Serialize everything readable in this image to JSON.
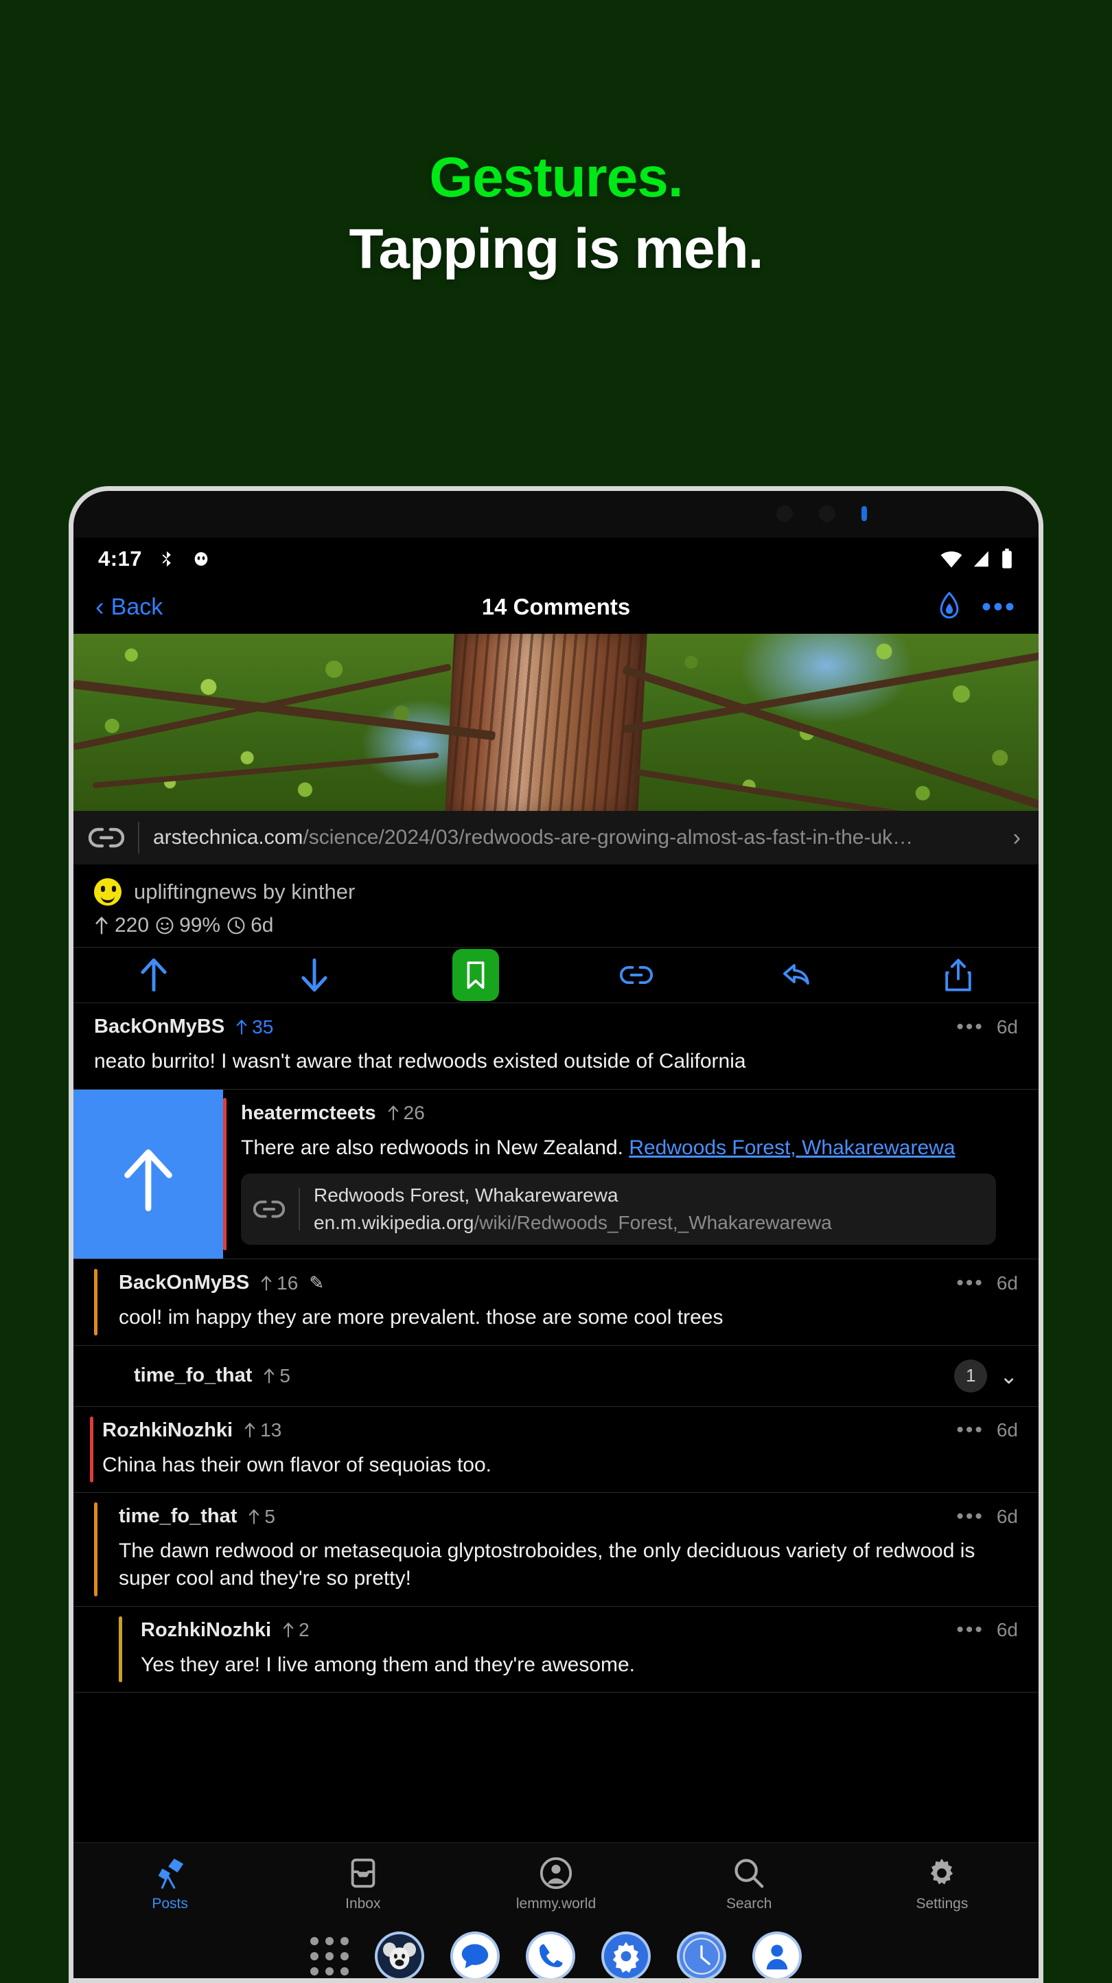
{
  "promo": {
    "line1": "Gestures.",
    "line2": "Tapping is meh.",
    "accent_color": "#00e815",
    "background_color": "#0a2d06"
  },
  "status_bar": {
    "time": "4:17",
    "icons": [
      "bluetooth-icon",
      "app-notification-icon",
      "wifi-icon",
      "cellular-signal-icon",
      "battery-icon"
    ]
  },
  "nav_bar": {
    "back_label": "Back",
    "title": "14 Comments",
    "flame_icon": "flame-icon",
    "more_label": "•••"
  },
  "post": {
    "url_display_domain": "arstechnica.com",
    "url_display_path": "/science/2024/03/redwoods-are-growing-almost-as-fast-in-the-uk…",
    "chevron": "›",
    "community": "upliftingnews",
    "by_label": "by",
    "author": "kinther",
    "score": "220",
    "percent": "99%",
    "age": "6d"
  },
  "action_bar": {
    "items": [
      {
        "name": "upvote-button",
        "icon": "arrow-up-icon"
      },
      {
        "name": "downvote-button",
        "icon": "arrow-down-icon"
      },
      {
        "name": "save-button",
        "icon": "bookmark-icon",
        "active": true,
        "active_color": "#18a51e"
      },
      {
        "name": "link-button",
        "icon": "link-icon"
      },
      {
        "name": "reply-button",
        "icon": "reply-arrow-icon"
      },
      {
        "name": "share-button",
        "icon": "share-icon"
      }
    ]
  },
  "swipe": {
    "action_icon": "arrow-up-icon",
    "action_color": "#3f8cf7"
  },
  "comments": [
    {
      "user": "BackOnMyBS",
      "score": "35",
      "score_highlight": true,
      "time": "6d",
      "body": "neato burrito! I wasn't aware that redwoods existed outside of California",
      "depth": 0,
      "rail_color": "transparent",
      "edited": false
    },
    {
      "user": "heatermcteets",
      "score": "26",
      "score_highlight": false,
      "time": "",
      "body_prefix": "There are also redwoods in New Zealand. ",
      "body_link": "Redwoods Forest, Whakarewarewa",
      "depth": 1,
      "rail_color": "#e03b3b",
      "embed": {
        "title": "Redwoods Forest, Whakarewarewa",
        "url_domain": "en.m.wikipedia.org",
        "url_path": "/wiki/Redwoods_Forest,_Whakarewarewa",
        "icon": "link-icon"
      }
    },
    {
      "user": "BackOnMyBS",
      "score": "16",
      "score_highlight": false,
      "time": "6d",
      "body": "cool! im happy they are more prevalent. those are some cool trees",
      "depth": 1,
      "rail_color": "#e08a20",
      "edited": true,
      "edited_glyph": "✎"
    },
    {
      "user": "time_fo_that",
      "score": "5",
      "score_highlight": false,
      "collapsed": true,
      "child_count": "1",
      "chevron": "⌄",
      "depth": 2,
      "rail_color": "#c9a227"
    },
    {
      "user": "RozhkiNozhki",
      "score": "13",
      "score_highlight": false,
      "time": "6d",
      "body": "China has their own flavor of sequoias too.",
      "depth": 0,
      "rail_color": "#e03b3b"
    },
    {
      "user": "time_fo_that",
      "score": "5",
      "score_highlight": false,
      "time": "6d",
      "body": "The dawn redwood or metasequoia glyptostroboides, the only deciduous variety of redwood is super cool and they're so pretty!",
      "depth": 1,
      "rail_color": "#e08a20"
    },
    {
      "user": "RozhkiNozhki",
      "score": "2",
      "score_highlight": false,
      "time": "6d",
      "body": "Yes they are! I live among them and they're awesome.",
      "depth": 2,
      "rail_color": "#c9a227"
    }
  ],
  "tab_bar": {
    "items": [
      {
        "label": "Posts",
        "icon": "telescope-icon",
        "active": true
      },
      {
        "label": "Inbox",
        "icon": "inbox-icon",
        "active": false
      },
      {
        "label": "lemmy.world",
        "icon": "account-circle-icon",
        "active": false
      },
      {
        "label": "Search",
        "icon": "search-icon",
        "active": false
      },
      {
        "label": "Settings",
        "icon": "gear-icon",
        "active": false
      }
    ],
    "active_color": "#3f8cf7"
  },
  "dock": {
    "app_drawer_icon": "app-grid-icon",
    "apps": [
      {
        "name": "thunder-app-icon"
      },
      {
        "name": "messages-app-icon"
      },
      {
        "name": "phone-app-icon"
      },
      {
        "name": "settings-app-icon"
      },
      {
        "name": "clock-app-icon"
      },
      {
        "name": "contacts-app-icon"
      }
    ]
  }
}
